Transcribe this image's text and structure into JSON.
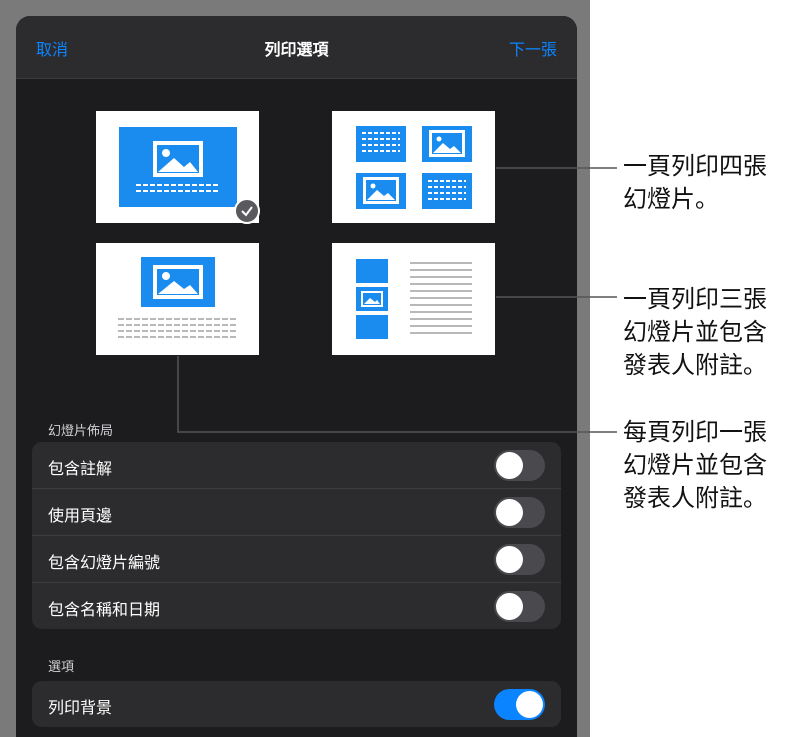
{
  "header": {
    "cancel_label": "取消",
    "title": "列印選項",
    "next_label": "下一張"
  },
  "layouts": [
    {
      "id": "one-per-page",
      "selected": true
    },
    {
      "id": "four-per-page",
      "selected": false
    },
    {
      "id": "one-with-notes",
      "selected": false
    },
    {
      "id": "three-with-notes",
      "selected": false
    }
  ],
  "slide_layout_section": {
    "label": "幻燈片佈局",
    "rows": [
      {
        "label": "包含註解",
        "on": false
      },
      {
        "label": "使用頁邊",
        "on": false
      },
      {
        "label": "包含幻燈片編號",
        "on": false
      },
      {
        "label": "包含名稱和日期",
        "on": false
      }
    ]
  },
  "options_section": {
    "label": "選項",
    "rows": [
      {
        "label": "列印背景",
        "on": true
      }
    ]
  },
  "callouts": [
    {
      "lines": [
        "一頁列印四張",
        "幻燈片。"
      ]
    },
    {
      "lines": [
        "一頁列印三張",
        "幻燈片並包含",
        "發表人附註。"
      ]
    },
    {
      "lines": [
        "每頁列印一張",
        "幻燈片並包含",
        "發表人附註。"
      ]
    }
  ],
  "colors": {
    "accent": "#0a84ff",
    "slide_blue": "#1a8cf0",
    "panel": "#1c1c1e"
  }
}
